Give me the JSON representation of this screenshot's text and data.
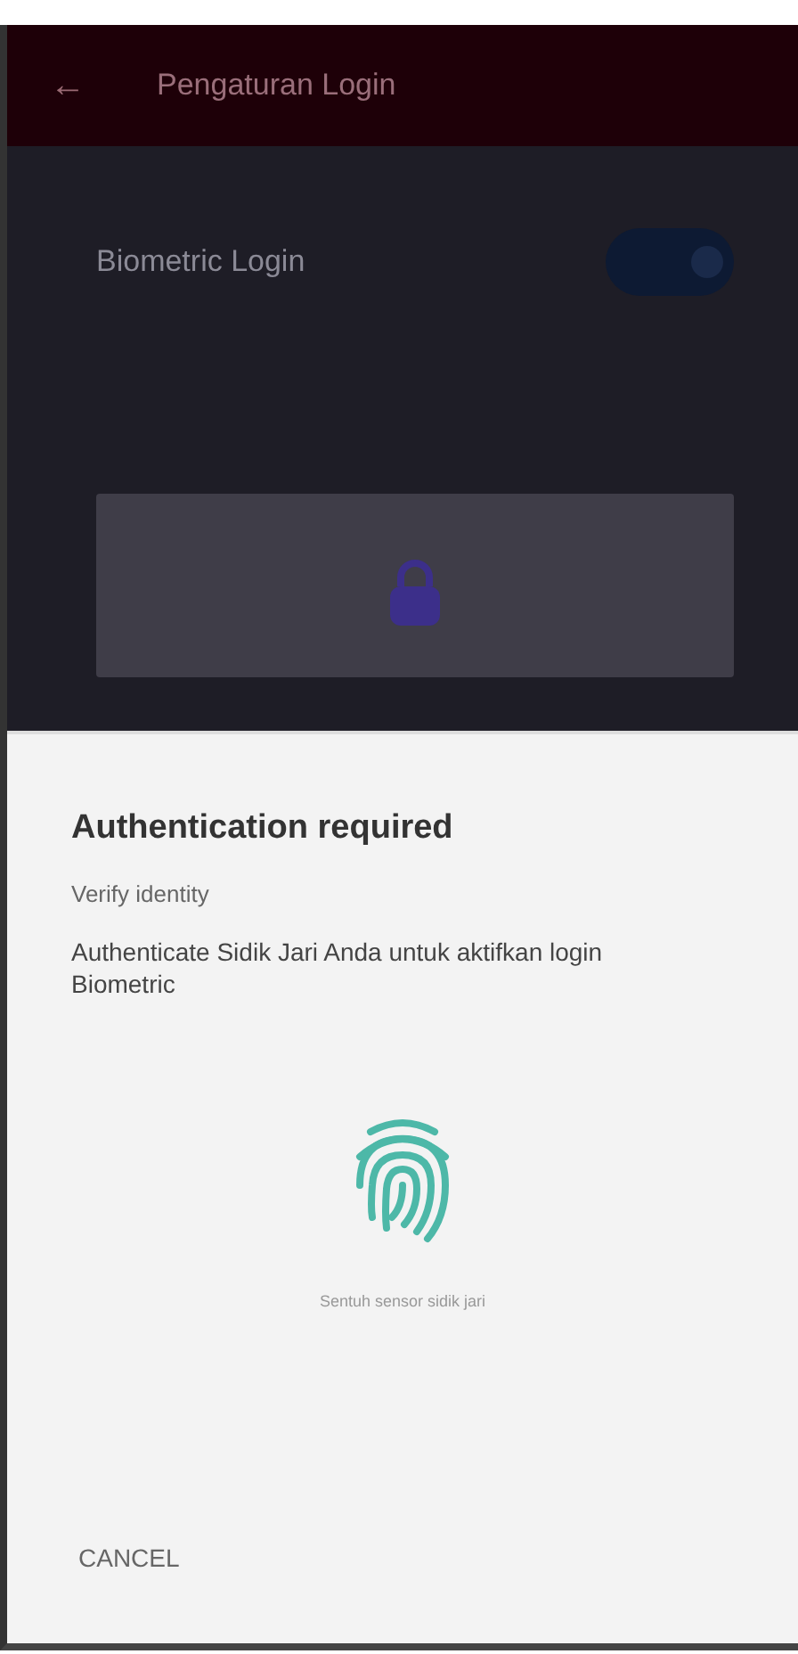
{
  "app_bar": {
    "back": "←",
    "title": "Pengaturan Login"
  },
  "settings": [
    {
      "label": "Biometric Login",
      "on": true
    }
  ],
  "dialog": {
    "title": "Authentication required",
    "subtitle": "Verify identity",
    "description": "Authenticate Sidik Jari Anda untuk aktifkan login Biometric",
    "hint": "Sentuh sensor sidik jari",
    "buttons": [
      "CANCEL"
    ]
  }
}
